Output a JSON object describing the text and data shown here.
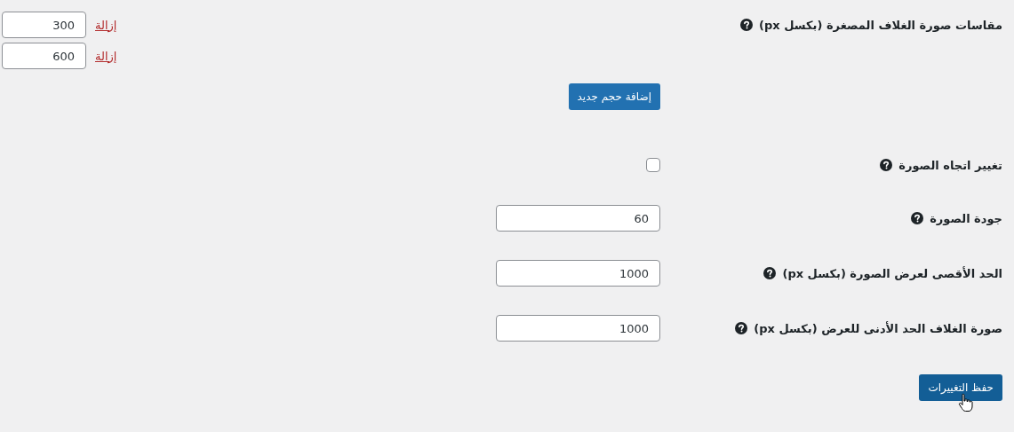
{
  "fields": [
    {
      "kind": "sizes",
      "label": "مقاسات صورة الغلاف المصغرة (بكسل px)",
      "sizes": [
        {
          "value": "300",
          "remove": "إزالة"
        },
        {
          "value": "600",
          "remove": "إزالة"
        }
      ],
      "add_button": "إضافة حجم جديد"
    },
    {
      "kind": "checkbox",
      "label": "تغيير اتجاه الصورة",
      "checked": false
    },
    {
      "kind": "number",
      "label": "جودة الصورة",
      "value": "60"
    },
    {
      "kind": "number",
      "label": "الحد الأقصى لعرض الصورة (بكسل px)",
      "value": "1000"
    },
    {
      "kind": "number",
      "label": "صورة الغلاف الحد الأدنى للعرض (بكسل px)",
      "value": "1000"
    }
  ],
  "save_button": "حفظ التغييرات"
}
